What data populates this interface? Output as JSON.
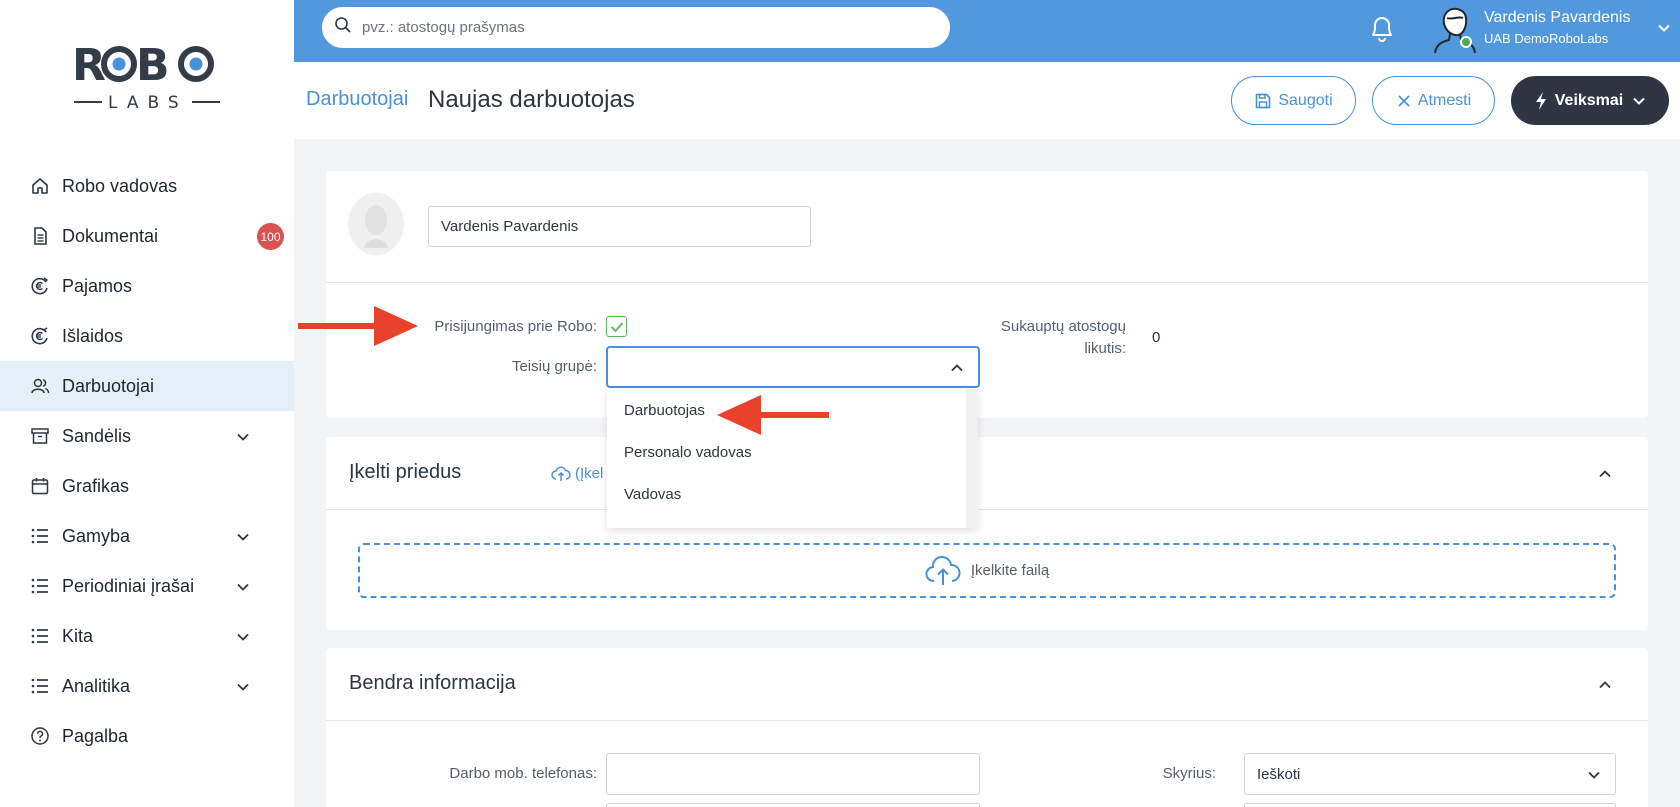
{
  "sidebar": {
    "logo_top": "ROBO",
    "logo_bottom": "LABS",
    "items": [
      {
        "label": "Robo vadovas",
        "icon": "home-icon"
      },
      {
        "label": "Dokumentai",
        "icon": "document-icon",
        "badge": "100"
      },
      {
        "label": "Pajamos",
        "icon": "euro-in-icon"
      },
      {
        "label": "Išlaidos",
        "icon": "euro-out-icon"
      },
      {
        "label": "Darbuotojai",
        "icon": "users-icon",
        "active": true
      },
      {
        "label": "Sandėlis",
        "icon": "archive-icon",
        "expandable": true
      },
      {
        "label": "Grafikas",
        "icon": "calendar-icon"
      },
      {
        "label": "Gamyba",
        "icon": "list-icon",
        "expandable": true
      },
      {
        "label": "Periodiniai įrašai",
        "icon": "list-icon",
        "expandable": true
      },
      {
        "label": "Kita",
        "icon": "list-icon",
        "expandable": true
      },
      {
        "label": "Analitika",
        "icon": "list-icon",
        "expandable": true
      },
      {
        "label": "Pagalba",
        "icon": "help-icon"
      }
    ]
  },
  "topbar": {
    "search_placeholder": "pvz.: atostogų prašymas",
    "user_name": "Vardenis Pavardenis",
    "user_company": "UAB DemoRoboLabs"
  },
  "header": {
    "breadcrumb": "Darbuotojai",
    "title": "Naujas darbuotojas",
    "save_label": "Saugoti",
    "cancel_label": "Atmesti",
    "actions_label": "Veiksmai"
  },
  "employee": {
    "name_value": "Vardenis Pavardenis",
    "login_label": "Prisijungimas prie Robo:",
    "login_checked": true,
    "rights_label": "Teisių grupė:",
    "leave_label_1": "Sukauptų atostogų",
    "leave_label_2": "likutis:",
    "leave_value": "0"
  },
  "rights_dropdown": {
    "options": [
      "Darbuotojas",
      "Personalo vadovas",
      "Vadovas"
    ]
  },
  "attachments": {
    "title": "Įkelti priedus",
    "link_text": "(Įkel",
    "dropzone_text": "Įkelkite failą"
  },
  "general_info": {
    "title": "Bendra informacija",
    "phone_label": "Darbo mob. telefonas:",
    "department_label": "Skyrius:",
    "department_value": "Ieškoti"
  },
  "colors": {
    "accent": "#4a90d9",
    "topbar": "#5199dc",
    "dark_button": "#2d3642",
    "badge": "#d9534f",
    "annotation_arrow": "#e8412c"
  }
}
